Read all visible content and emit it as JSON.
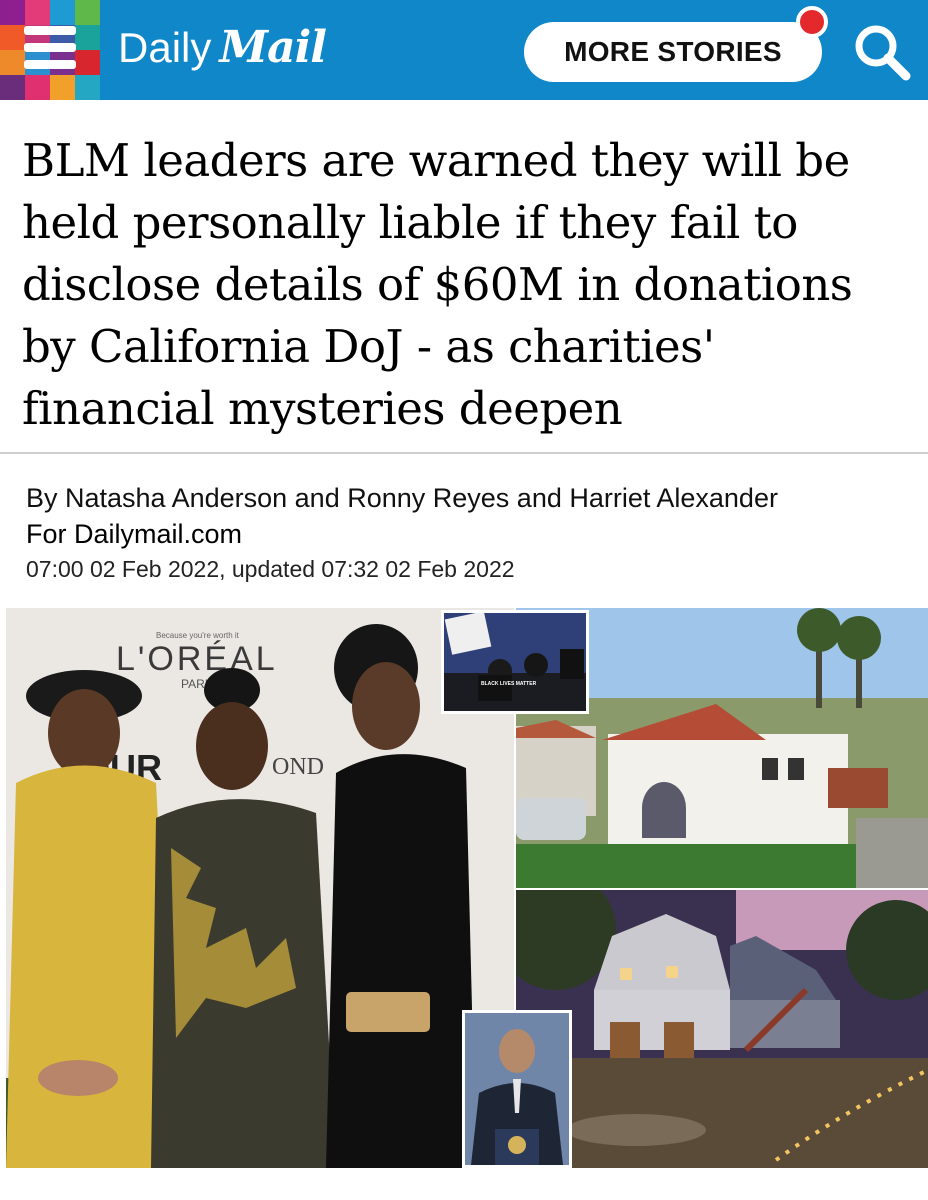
{
  "header": {
    "logo_daily": "Daily",
    "logo_mail": "Mail",
    "more_stories_label": "MORE STORIES",
    "colors": {
      "bar": "#0f87c9",
      "notification": "#e4292d"
    },
    "icons": {
      "menu": "menu-icon",
      "search": "search-icon",
      "notification": "notification-dot-icon"
    }
  },
  "article": {
    "headline": "BLM leaders are warned they will be held personally liable if they fail to disclose details of $60M in donations by California DoJ - as charities' financial mysteries deepen",
    "byline_authors": "By Natasha Anderson and Ronny Reyes and Harriet Alexander",
    "byline_outlet": "For Dailymail.com",
    "date": "07:00 02 Feb 2022, updated 07:32 02 Feb 2022"
  },
  "images": {
    "backdrop_tagline": "Because you're worth it",
    "backdrop_brand": "L'ORÉAL",
    "backdrop_brand_sub": "PARIS",
    "backdrop_frag_1": "OUR",
    "backdrop_frag_2": "OND",
    "protest_sign": "BLACK LIVES MATTER"
  }
}
